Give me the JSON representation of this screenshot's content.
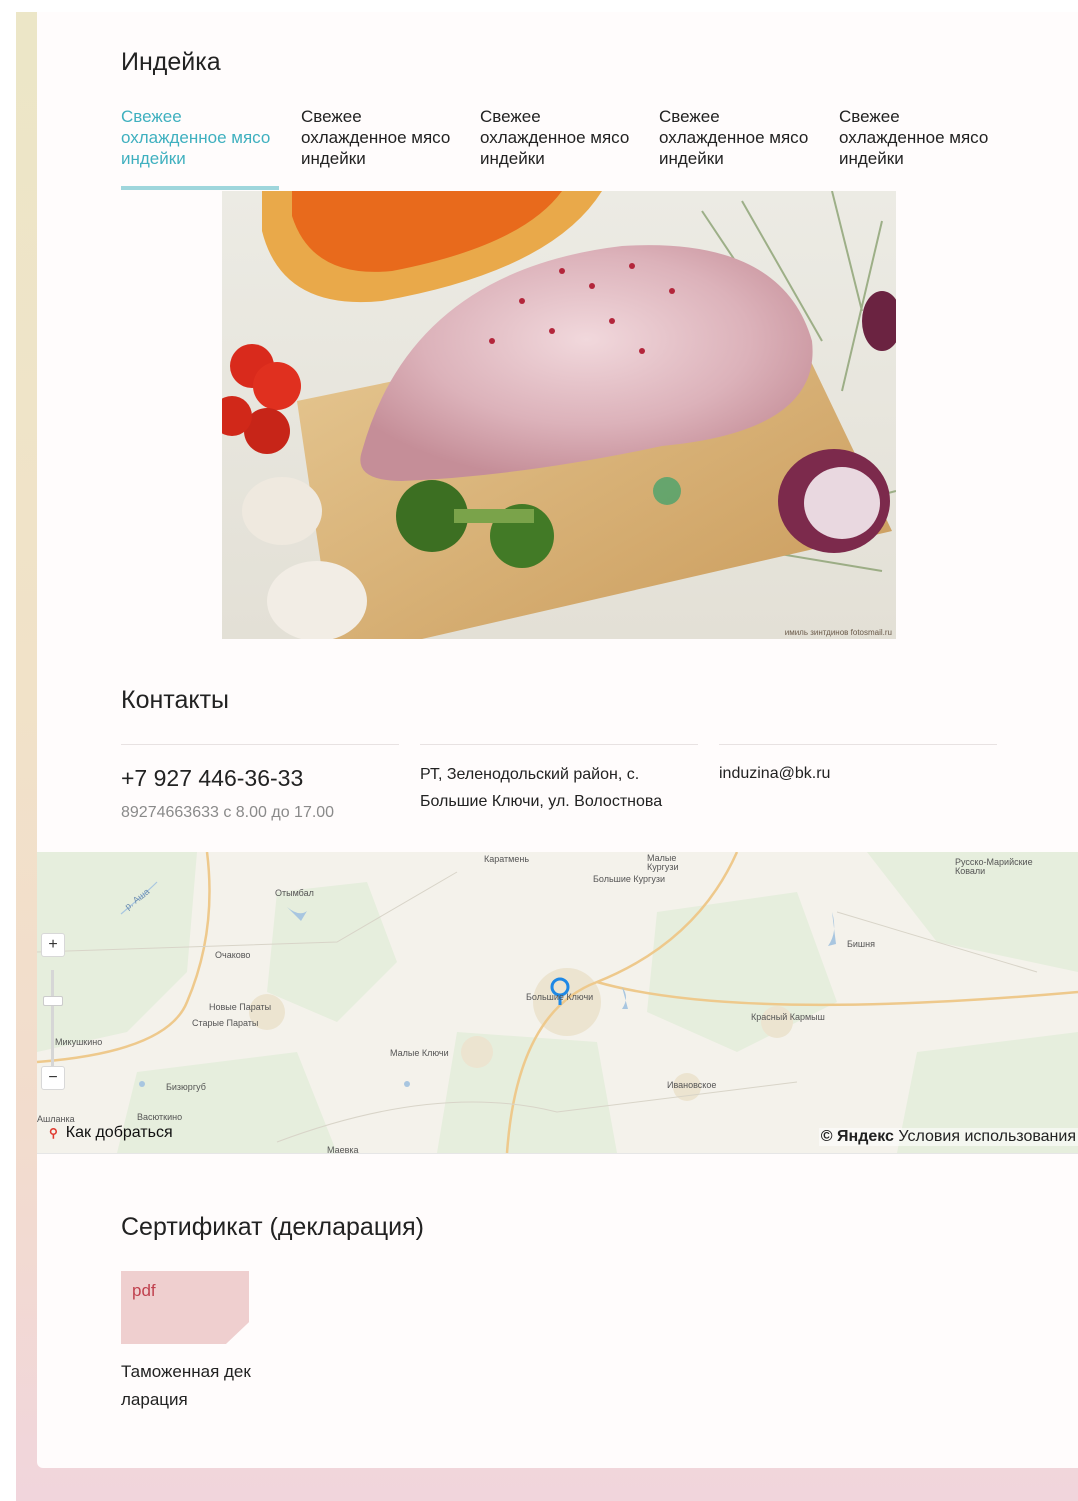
{
  "product": {
    "title": "Индейка",
    "tabs": [
      {
        "label": "Свежее охлажденное мясо индейки",
        "active": true
      },
      {
        "label": "Свежее охлажденное мясо индейки",
        "active": false
      },
      {
        "label": "Свежее охлажденное мясо индейки",
        "active": false
      },
      {
        "label": "Свежее охлажденное мясо индейки",
        "active": false
      },
      {
        "label": "Свежее охлажденное мясо индейки",
        "active": false
      }
    ],
    "photo_credit": "имиль зинтдинов fotosmail.ru"
  },
  "contacts": {
    "title": "Контакты",
    "phone": "+7 927 446-36-33",
    "phone_note": "89274663633 с 8.00 до 17.00",
    "address": "РТ, Зеленодольский район, с. Большие Ключи, ул. Волостнова",
    "email": "induzina@bk.ru"
  },
  "map": {
    "places": [
      "Каратмень",
      "Малые Кургузи",
      "Большие Кургузи",
      "Русско-Марийские Ковали",
      "Отымбал",
      "Очаково",
      "Бишня",
      "Большие Ключи",
      "Новые Параты",
      "Старые Параты",
      "Красный Кармыш",
      "Микушкино",
      "Малые Ключи",
      "Бизюргуб",
      "Ивановское",
      "Ашланка",
      "Васюткино",
      "Маевка",
      "р. Аша"
    ],
    "zoom_in": "+",
    "zoom_out": "−",
    "route_icon": "map-pin-icon",
    "route_label": "Как добраться",
    "copyright": "© Яндекс",
    "terms": "Условия использования"
  },
  "certificate": {
    "title": "Сертификат (декларация)",
    "file_type": "pdf",
    "file_name": "Таможенная декларация"
  },
  "colors": {
    "accent": "#3fb0bf",
    "pdf_tile": "#efcfcf",
    "pdf_text": "#c0414e"
  }
}
